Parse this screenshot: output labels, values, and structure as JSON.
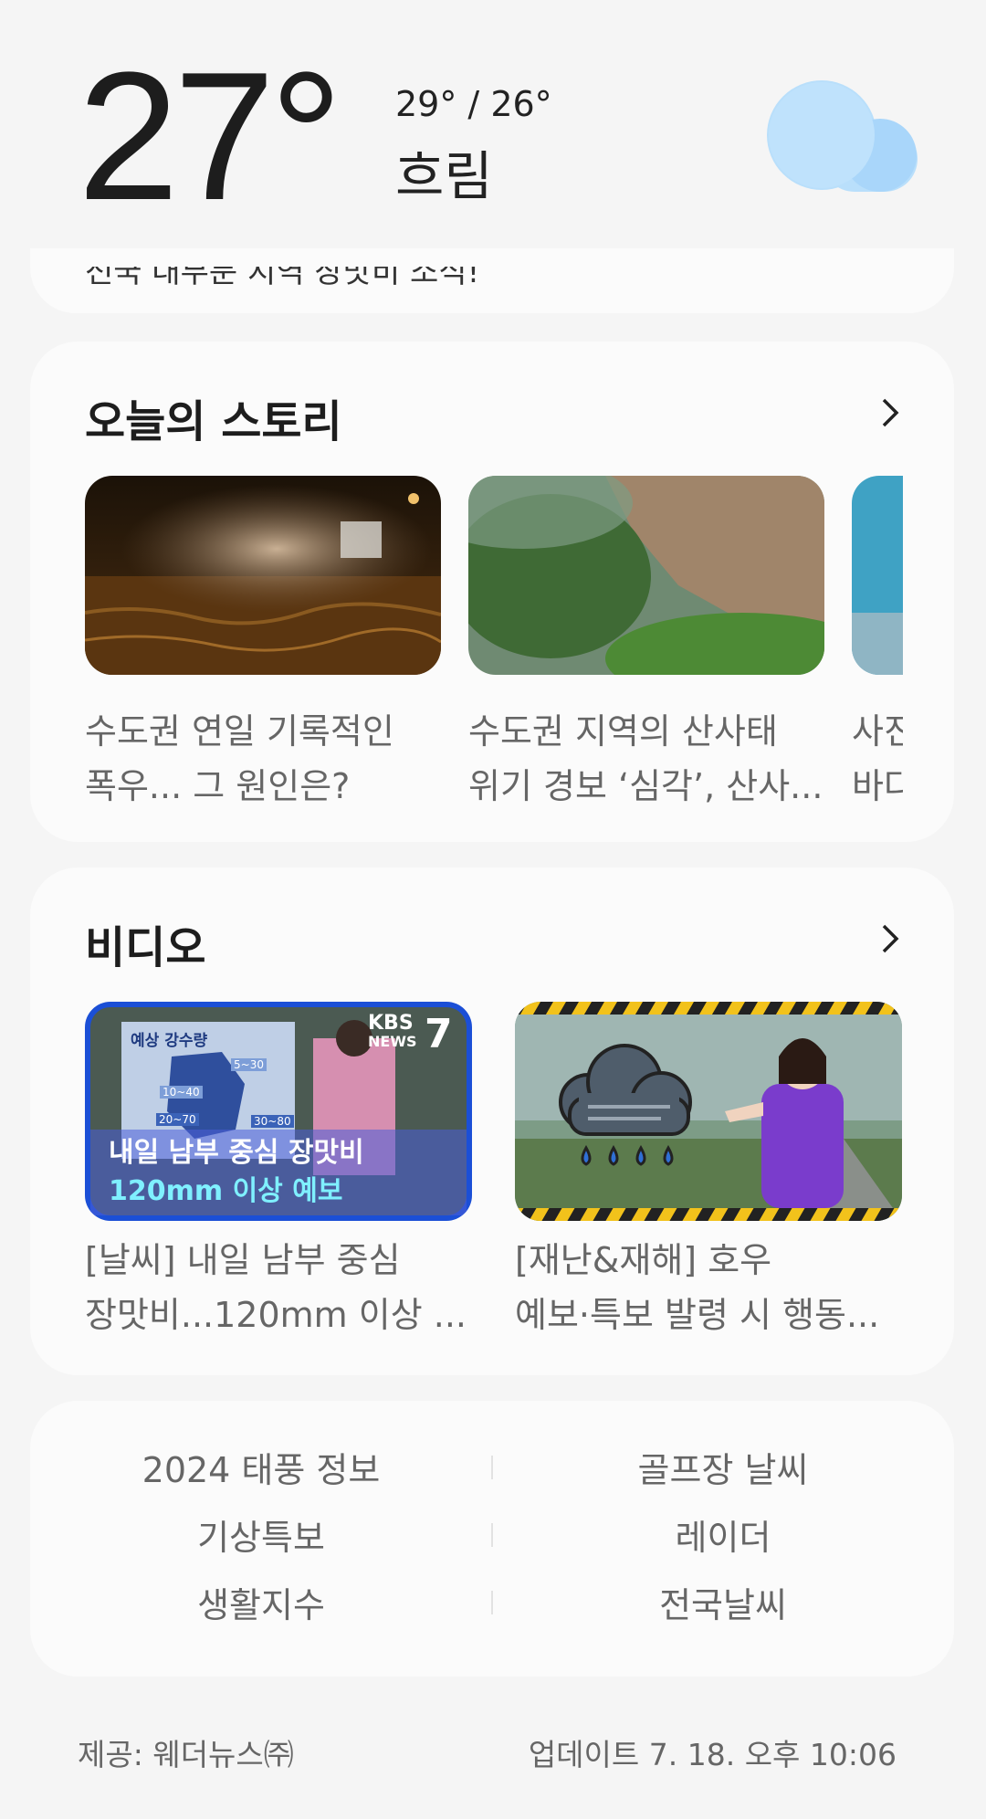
{
  "weather": {
    "temperature": "27°",
    "high_low": "29° / 26°",
    "condition": "흐림",
    "icon": "cloud-icon"
  },
  "top_card": {
    "partial_text": "전국 대부분 지역 장맛비 소식!"
  },
  "stories": {
    "title": "오늘의 스토리",
    "items": [
      {
        "line1": "수도권 연일 기록적인",
        "line2": "폭우... 그 원인은?",
        "image": "flooded-road-car-splash"
      },
      {
        "line1": "수도권 지역의 산사태",
        "line2": "위기 경보 ‘심각’, 산사...",
        "image": "landslide-hillside"
      },
      {
        "line1": "사진",
        "line2": "바다",
        "image": "sea-water"
      }
    ]
  },
  "videos": {
    "title": "비디오",
    "items": [
      {
        "line1": "[날씨] 내일 남부 중심",
        "line2": "장맛비...120mm 이상 ...",
        "thumb": {
          "map_title": "예상 강수량",
          "brand": "KBS",
          "brand_sub": "NEWS",
          "channel": "7",
          "headline1": "내일 남부 중심 장맛비",
          "headline2": "120mm 이상 예보",
          "map_labels": [
            "5~30",
            "10~40",
            "20~70",
            "30~80"
          ]
        }
      },
      {
        "line1": "[재난&재해] 호우",
        "line2": "예보·특보 발령 시 행동...",
        "thumb": {
          "icon": "rain-cloud-icon"
        }
      }
    ]
  },
  "links": [
    {
      "left": "2024 태풍 정보",
      "right": "골프장 날씨"
    },
    {
      "left": "기상특보",
      "right": "레이더"
    },
    {
      "left": "생활지수",
      "right": "전국날씨"
    }
  ],
  "footer": {
    "provider": "제공: 웨더뉴스㈜",
    "updated": "업데이트 7. 18. 오후 10:06"
  },
  "colors": {
    "background": "#f5f5f5",
    "card": "#fbfbfb",
    "cloud": "#b9dffb"
  }
}
